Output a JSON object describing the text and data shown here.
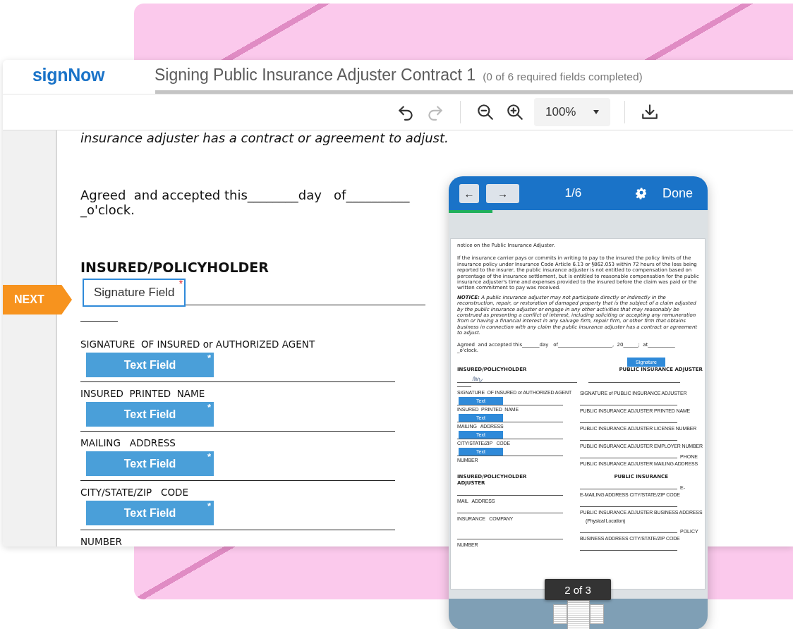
{
  "app": {
    "logo": "signNow",
    "title": "Signing Public Insurance Adjuster Contract 1",
    "status": "(0 of 6 required fields completed)"
  },
  "toolbar": {
    "buttons": [
      {
        "kind": "undo",
        "disabled": false
      },
      {
        "kind": "redo",
        "disabled": true
      },
      {
        "kind": "zoom_out",
        "disabled": false
      },
      {
        "kind": "zoom_in",
        "disabled": false
      }
    ],
    "zoom": "100%"
  },
  "document": {
    "top_text": "insurance adjuster has a contract or agreement to adjust.",
    "agreed": "Agreed  and accepted this________day   of__________",
    "oclock": "_o'clock.",
    "section": "INSURED/POLICYHOLDER",
    "next": "NEXT",
    "signature_field": {
      "label": "Signature Field",
      "required_mark": "*"
    },
    "items": [
      {
        "kind": "label",
        "text": "SIGNATURE  OF INSURED or AUTHORIZED AGENT"
      },
      {
        "kind": "field",
        "text": "Text Field",
        "required_mark": "*"
      },
      {
        "kind": "label",
        "text": "INSURED  PRINTED  NAME"
      },
      {
        "kind": "field",
        "text": "Text Field",
        "required_mark": "*"
      },
      {
        "kind": "label",
        "text": "MAILING   ADDRESS"
      },
      {
        "kind": "field",
        "text": "Text Field",
        "required_mark": "*"
      },
      {
        "kind": "label",
        "text": "CITY/STATE/ZIP   CODE"
      },
      {
        "kind": "field",
        "text": "Text Field",
        "required_mark": "*"
      },
      {
        "kind": "label",
        "text": "NUMBER"
      }
    ]
  },
  "phone": {
    "back": "←",
    "forward": "→",
    "page": "1/6",
    "done": "Done",
    "progress": {
      "level": 0.17
    },
    "page_indicator": "2 of 3",
    "thumbnails": [
      {
        "selected": false
      },
      {
        "selected": true
      },
      {
        "selected": false
      }
    ],
    "document": {
      "paragraphs": [
        "notice on the Public Insurance Adjuster.",
        "If the insurance carrier pays or commits in writing to pay to the insured the policy limits of the insurance policy under Insurance Code Article 6.13 or §862.053 within 72 hours of the loss being reported to the insurer, the public insurance adjuster is not entitled to compensation based on percentage of the insurance settlement, but is entitled to reasonable compensation for the public insurance adjuster's time and expenses provided to the insured before the claim was paid or the written commitment to pay was received.",
        "**NOTICE:** A public insurance adjuster may not participate directly or indirectly in the reconstruction, repair, or restoration of damaged property that is the subject of a claim adjusted by the public insurance adjuster or engage in any other activities that may reasonably be construed as presenting a conflict of interest, including soliciting or accepting any remuneration from or having a financial interest in any salvage firm, repair firm, or other firm that obtains business in connection with any claim the public insurance adjuster has a contract or agreement to adjust."
      ],
      "agreed": "Agreed  and accepted this_______day   of______________________,  20______;  at___________",
      "oclock": "_o'clock.",
      "signature_button": "Signature",
      "section_1": {
        "left_heading": "INSURED/POLICYHOLDER",
        "right_heading": "PUBLIC INSURANCE ADJUSTER",
        "left": [
          {
            "kind": "label",
            "text": "SIGNATURE  OF INSURED or AUTHORIZED AGENT"
          },
          {
            "kind": "field",
            "text": "Text"
          },
          {
            "kind": "label",
            "text": "INSURED  PRINTED  NAME"
          },
          {
            "kind": "field",
            "text": "Text"
          },
          {
            "kind": "label",
            "text": "MAILING   ADDRESS"
          },
          {
            "kind": "field",
            "text": "Text"
          },
          {
            "kind": "label",
            "text": "CITY/STATE/ZIP   CODE"
          },
          {
            "kind": "field",
            "text": "Text"
          },
          {
            "kind": "label",
            "text": "NUMBER"
          }
        ],
        "right": [
          {
            "kind": "label",
            "text": "SIGNATURE of PUBLIC INSURANCE ADJUSTER"
          },
          {
            "kind": "line"
          },
          {
            "kind": "label",
            "text": "PUBLIC INSURANCE ADJUSTER PRINTED NAME"
          },
          {
            "kind": "line"
          },
          {
            "kind": "label",
            "text": "PUBLIC INSURANCE ADJUSTER LICENSE NUMBER"
          },
          {
            "kind": "line"
          },
          {
            "kind": "label",
            "text": "PUBLIC INSURANCE ADJUSTER EMPLOYER NUMBER"
          },
          {
            "kind": "line",
            "suffix": "PHONE"
          },
          {
            "kind": "label",
            "text": "PUBLIC INSURANCE ADJUSTER MAILING ADDRESS"
          }
        ]
      },
      "section_2": {
        "left_heading": "INSURED/POLICYHOLDER ADJUSTER",
        "right_heading": "PUBLIC INSURANCE",
        "left": [
          {
            "kind": "line"
          },
          {
            "kind": "label",
            "text": "MAIL   ADDRESS"
          },
          {
            "kind": "line"
          },
          {
            "kind": "label",
            "text": "INSURANCE   COMPANY"
          },
          {
            "kind": "gap"
          },
          {
            "kind": "line"
          },
          {
            "kind": "label",
            "text": "NUMBER"
          }
        ],
        "right": [
          {
            "kind": "line",
            "suffix": "E-"
          },
          {
            "kind": "label",
            "text": "E-MAILING ADDRESS CITY/STATE/ZIP CODE"
          },
          {
            "kind": "line"
          },
          {
            "kind": "label",
            "text": "PUBLIC INSURANCE ADJUSTER BUSINESS ADDRESS"
          },
          {
            "kind": "note",
            "text": "(Physical Location)"
          },
          {
            "kind": "line",
            "suffix": "POLICY"
          },
          {
            "kind": "label",
            "text": "BUSINESS ADDRESS CITY/STATE/ZIP CODE"
          },
          {
            "kind": "line"
          }
        ]
      }
    }
  }
}
